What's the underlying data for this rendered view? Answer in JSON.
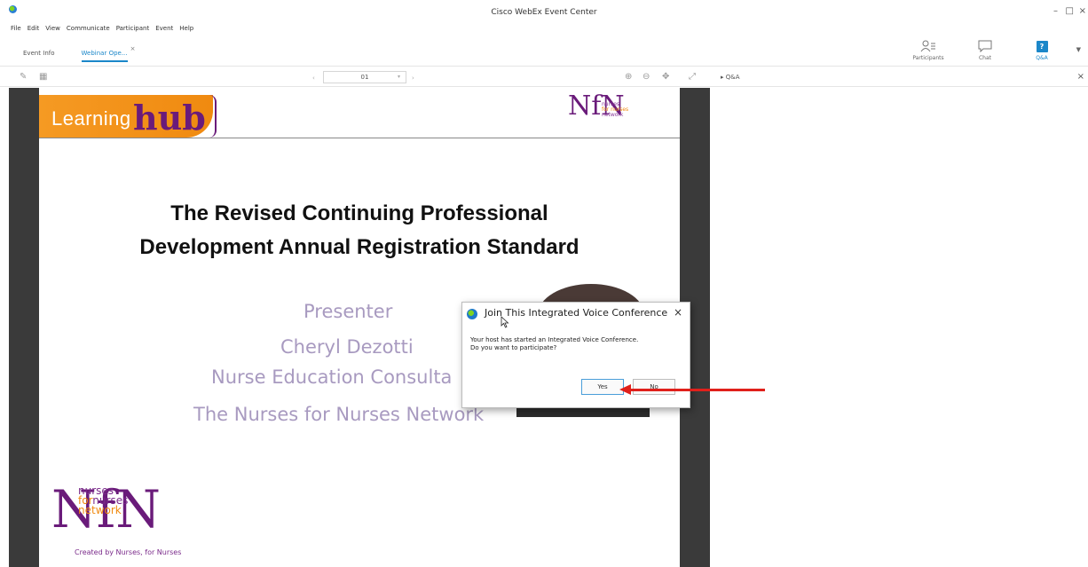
{
  "window": {
    "title": "Cisco WebEx Event Center",
    "min": "–",
    "max": "□",
    "close": "×"
  },
  "menu": [
    "File",
    "Edit",
    "View",
    "Communicate",
    "Participant",
    "Event",
    "Help"
  ],
  "tabs": [
    {
      "label": "Event Info"
    },
    {
      "label": "Webinar Ope...",
      "close": "×"
    }
  ],
  "panels": [
    {
      "label": "Participants"
    },
    {
      "label": "Chat"
    },
    {
      "label": "Q&A",
      "icon_text": "?"
    }
  ],
  "viewer": {
    "page_value": "01"
  },
  "qa_panel": {
    "title": "Q&A"
  },
  "slide": {
    "banner_left": "Learning",
    "banner_right": "hub",
    "logo_mono": "NfN",
    "logo_small_1": "nurses",
    "logo_small_2": "for nurses",
    "logo_small_3": "network",
    "title_line1": "The Revised Continuing Professional",
    "title_line2": "Development Annual Registration Standard",
    "presenter_label": "Presenter",
    "presenter_name": "Cheryl Dezotti",
    "presenter_role": "Nurse Education Consulta",
    "presenter_org": "The Nurses for Nurses Network",
    "bottom_line1": "nurses",
    "bottom_line2a": "for",
    "bottom_line2b": "nurses",
    "bottom_line3": "network",
    "tagline": "Created by Nurses, for Nurses"
  },
  "dialog": {
    "title": "Join This Integrated Voice Conference",
    "close": "×",
    "message_line1": "Your host has started an Integrated Voice Conference.",
    "message_line2": "Do you want to participate?",
    "yes": "Yes",
    "no": "No"
  },
  "colors": {
    "accent": "#1b87c9",
    "annotation": "#e0201b",
    "brand_purple": "#6a1b7a",
    "brand_orange": "#f08a10"
  }
}
